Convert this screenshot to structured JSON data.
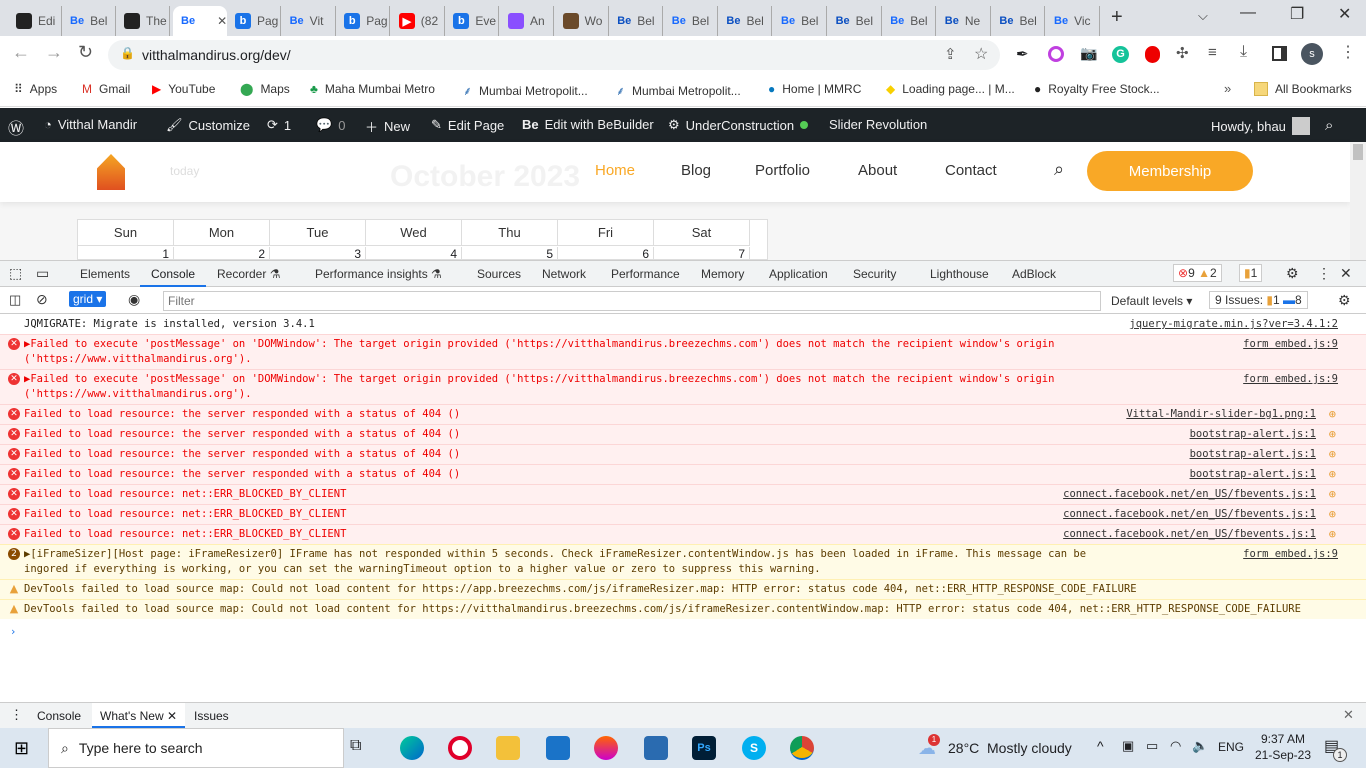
{
  "browser": {
    "tabs": [
      {
        "label": "Edi",
        "icon": "pin",
        "c": "#222"
      },
      {
        "label": "Bel",
        "icon": "Be",
        "c": "#1769ff"
      },
      {
        "label": "The",
        "icon": "pin",
        "c": "#222"
      },
      {
        "label": "",
        "icon": "Be",
        "c": "#1769ff",
        "active": true
      },
      {
        "label": "Pag",
        "icon": "b",
        "c": "#1a73e8"
      },
      {
        "label": "Vit",
        "icon": "Be",
        "c": "#1769ff"
      },
      {
        "label": "Pag",
        "icon": "b",
        "c": "#1a73e8"
      },
      {
        "label": "(82",
        "icon": "yt",
        "c": "#f00"
      },
      {
        "label": "Eve",
        "icon": "b",
        "c": "#1a73e8"
      },
      {
        "label": "An",
        "icon": "o",
        "c": "#8a4fff"
      },
      {
        "label": "Wo",
        "icon": "w",
        "c": "#6b4a2a"
      },
      {
        "label": "Bel",
        "icon": "Be",
        "c": "#0b4fc1"
      },
      {
        "label": "Bel",
        "icon": "Be",
        "c": "#1769ff"
      },
      {
        "label": "Bel",
        "icon": "Be",
        "c": "#0b4fc1"
      },
      {
        "label": "Bel",
        "icon": "Be",
        "c": "#1769ff"
      },
      {
        "label": "Bel",
        "icon": "Be",
        "c": "#0b4fc1"
      },
      {
        "label": "Bel",
        "icon": "Be",
        "c": "#1769ff"
      },
      {
        "label": "Ne",
        "icon": "Be",
        "c": "#0b4fc1"
      },
      {
        "label": "Bel",
        "icon": "Be",
        "c": "#0b4fc1"
      },
      {
        "label": "Vic",
        "icon": "Be",
        "c": "#1769ff"
      }
    ],
    "url": "vitthalmandirus.org/dev/",
    "profile_initial": "s",
    "bookmarks": [
      "Apps",
      "Gmail",
      "YouTube",
      "Maps",
      "Maha Mumbai Metro",
      "Mumbai Metropolit...",
      "Mumbai Metropolit...",
      "Home | MMRC",
      "Loading page... | M...",
      "Royalty Free Stock..."
    ],
    "more": "»",
    "all_bookmarks": "All Bookmarks"
  },
  "wp_admin": {
    "site": "Vitthal Mandir",
    "customize": "Customize",
    "updates": "1",
    "comments": "0",
    "new": "New",
    "edit_page": "Edit Page",
    "be": "Be",
    "bebuilder": "Edit with BeBuilder",
    "underconstruction": "UnderConstruction",
    "slider": "Slider Revolution",
    "howdy": "Howdy, bhau"
  },
  "site": {
    "nav": [
      "Home",
      "Blog",
      "Portfolio",
      "About",
      "Contact"
    ],
    "membership": "Membership",
    "calendar_title": "October 2023",
    "today": "today",
    "weekdays": [
      "Sun",
      "Mon",
      "Tue",
      "Wed",
      "Thu",
      "Fri",
      "Sat"
    ],
    "days": [
      "1",
      "2",
      "3",
      "4",
      "5",
      "6",
      "7"
    ]
  },
  "devtools": {
    "tabs": [
      "Elements",
      "Console",
      "Recorder ⚗",
      "Performance insights ⚗",
      "Sources",
      "Network",
      "Performance",
      "Memory",
      "Application",
      "Security",
      "Lighthouse",
      "AdBlock"
    ],
    "active_tab": "Console",
    "errors": "9",
    "warnings": "2",
    "issues_count": "1",
    "context": "grid",
    "filter_placeholder": "Filter",
    "levels": "Default levels",
    "issues_label": "9 Issues:",
    "issues_warn": "1",
    "issues_info": "8",
    "messages": [
      {
        "type": "info",
        "text": "JQMIGRATE: Migrate is installed, version 3.4.1",
        "src": "jquery-migrate.min.js?ver=3.4.1:2"
      },
      {
        "type": "err",
        "text": "▶Failed to execute 'postMessage' on 'DOMWindow': The target origin provided ('https://vitthalmandirus.breezechms.com') does not match the recipient window's origin ('https://www.vitthalmandirus.org').",
        "src": "form embed.js:9"
      },
      {
        "type": "err",
        "text": "▶Failed to execute 'postMessage' on 'DOMWindow': The target origin provided ('https://vitthalmandirus.breezechms.com') does not match the recipient window's origin ('https://www.vitthalmandirus.org').",
        "src": "form embed.js:9"
      },
      {
        "type": "err",
        "text": "Failed to load resource: the server responded with a status of 404 ()",
        "src": "Vittal-Mandir-slider-bg1.png:1",
        "ic": true
      },
      {
        "type": "err",
        "text": "Failed to load resource: the server responded with a status of 404 ()",
        "src": "bootstrap-alert.js:1",
        "ic": true
      },
      {
        "type": "err",
        "text": "Failed to load resource: the server responded with a status of 404 ()",
        "src": "bootstrap-alert.js:1",
        "ic": true
      },
      {
        "type": "err",
        "text": "Failed to load resource: the server responded with a status of 404 ()",
        "src": "bootstrap-alert.js:1",
        "ic": true
      },
      {
        "type": "err",
        "text": "Failed to load resource: net::ERR_BLOCKED_BY_CLIENT",
        "src": "connect.facebook.net/en_US/fbevents.js:1",
        "ic": true
      },
      {
        "type": "err",
        "text": "Failed to load resource: net::ERR_BLOCKED_BY_CLIENT",
        "src": "connect.facebook.net/en_US/fbevents.js:1",
        "ic": true
      },
      {
        "type": "err",
        "text": "Failed to load resource: net::ERR_BLOCKED_BY_CLIENT",
        "src": "connect.facebook.net/en_US/fbevents.js:1",
        "ic": true
      },
      {
        "type": "warn",
        "count": "2",
        "text": "▶[iFrameSizer][Host page: iFrameResizer0] IFrame has not responded within 5 seconds. Check iFrameResizer.contentWindow.js has been loaded in iFrame. This message can be ingored if everything is working, or you can set the warningTimeout option to a higher value or zero to suppress this warning.",
        "src": "form embed.js:9"
      },
      {
        "type": "warn",
        "text": "DevTools failed to load source map: Could not load content for https://app.breezechms.com/js/iframeResizer.map: HTTP error: status code 404, net::ERR_HTTP_RESPONSE_CODE_FAILURE",
        "src": ""
      },
      {
        "type": "warn",
        "text": "DevTools failed to load source map: Could not load content for https://vitthalmandirus.breezechms.com/js/iframeResizer.contentWindow.map: HTTP error: status code 404, net::ERR_HTTP_RESPONSE_CODE_FAILURE",
        "src": ""
      }
    ],
    "prompt": "›",
    "drawer_tabs": [
      "Console",
      "What's New",
      "Issues"
    ]
  },
  "taskbar": {
    "search_placeholder": "Type here to search",
    "temp": "28°C",
    "weather": "Mostly cloudy",
    "weather_badge": "1",
    "lang": "ENG",
    "time": "9:37 AM",
    "date": "21-Sep-23",
    "notif": "1"
  }
}
